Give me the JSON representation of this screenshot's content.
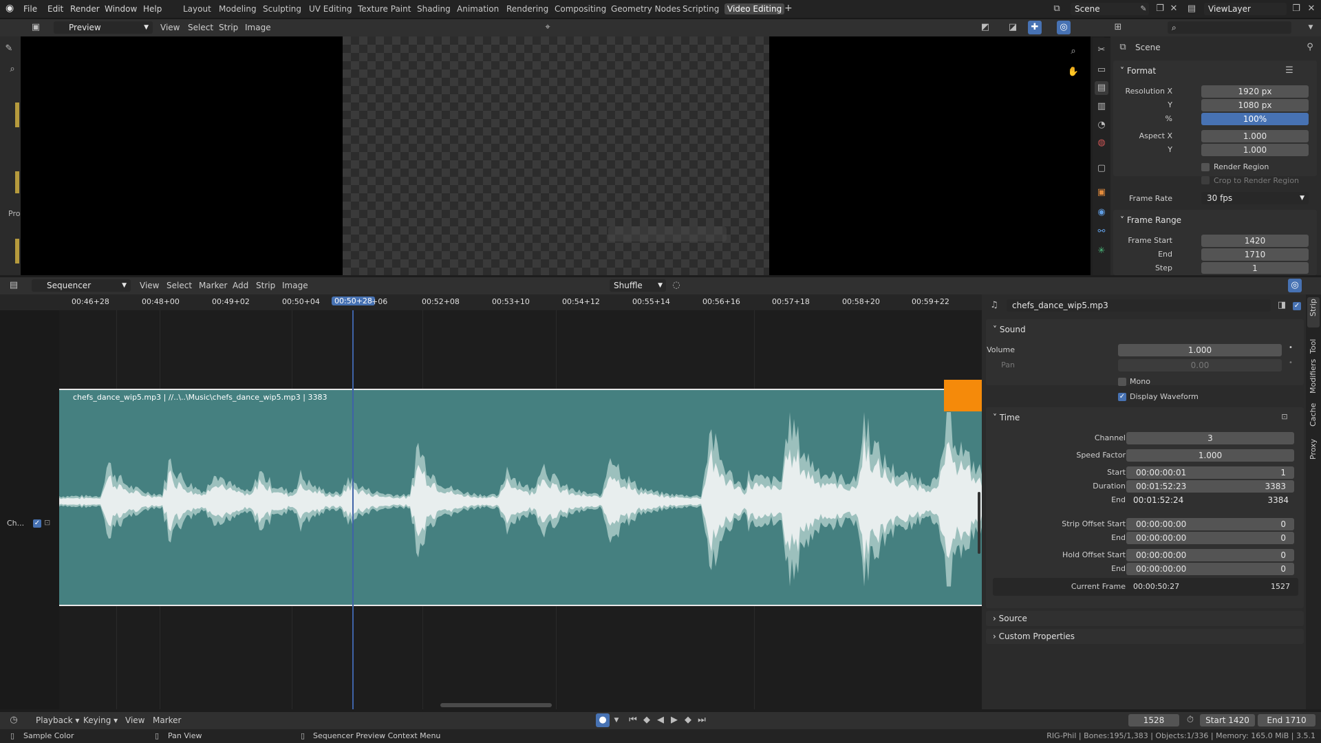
{
  "topbar": {
    "menus": [
      "File",
      "Edit",
      "Render",
      "Window",
      "Help"
    ],
    "workspaces": [
      "Layout",
      "Modeling",
      "Sculpting",
      "UV Editing",
      "Texture Paint",
      "Shading",
      "Animation",
      "Rendering",
      "Compositing",
      "Geometry Nodes",
      "Scripting",
      "Video Editing"
    ],
    "active_workspace": "Video Editing",
    "add_tab": "+",
    "scene_name": "Scene",
    "view_layer": "ViewLayer"
  },
  "preview": {
    "mode": "Preview",
    "menus": [
      "View",
      "Select",
      "Strip",
      "Image"
    ],
    "sidebar_label": "Pro"
  },
  "properties": {
    "scene_label": "Scene",
    "format": {
      "title": "Format",
      "resolution_x_label": "Resolution X",
      "resolution_x": "1920 px",
      "y_label": "Y",
      "resolution_y": "1080 px",
      "pct_label": "%",
      "resolution_pct": "100%",
      "aspect_x_label": "Aspect X",
      "aspect_x": "1.000",
      "aspect_y_label": "Y",
      "aspect_y": "1.000",
      "render_region": "Render Region",
      "crop_region": "Crop to Render Region",
      "frame_rate_label": "Frame Rate",
      "frame_rate": "30 fps"
    },
    "frame_range": {
      "title": "Frame Range",
      "start_label": "Frame Start",
      "start": "1420",
      "end_label": "End",
      "end": "1710",
      "step_label": "Step",
      "step": "1"
    }
  },
  "sequencer": {
    "title": "Sequencer",
    "menus": [
      "View",
      "Select",
      "Marker",
      "Add",
      "Strip",
      "Image"
    ],
    "overlap_mode": "Shuffle",
    "ruler": [
      "00:46+28",
      "00:48+00",
      "00:49+02",
      "00:50+04",
      "00:50+28",
      "+06",
      "00:52+08",
      "00:53+10",
      "00:54+12",
      "00:55+14",
      "00:56+16",
      "00:57+18",
      "00:58+20",
      "00:59+22"
    ],
    "current_time": "00:50+28",
    "channel_label": "Ch...",
    "strip_label": "chefs_dance_wip5.mp3 | //..\\..\\Music\\chefs_dance_wip5.mp3 | 3383"
  },
  "strip_panel": {
    "strip_name": "chefs_dance_wip5.mp3",
    "tabs": [
      "Strip",
      "Tool",
      "Modifiers",
      "Cache",
      "Proxy"
    ],
    "sound": {
      "title": "Sound",
      "volume_label": "Volume",
      "volume": "1.000",
      "pan_label": "Pan",
      "pan": "0.00",
      "mono": "Mono",
      "display_waveform": "Display Waveform"
    },
    "time": {
      "title": "Time",
      "channel_label": "Channel",
      "channel": "3",
      "speed_label": "Speed Factor",
      "speed": "1.000",
      "start_label": "Start",
      "start_tc": "00:00:00:01",
      "start_frames": "1",
      "duration_label": "Duration",
      "duration_tc": "00:01:52:23",
      "duration_frames": "3383",
      "end_label": "End",
      "end_tc": "00:01:52:24",
      "end_frames": "3384",
      "offset_start_label": "Strip Offset Start",
      "offset_start_tc": "00:00:00:00",
      "offset_start_frames": "0",
      "offset_end_label": "End",
      "offset_end_tc": "00:00:00:00",
      "offset_end_frames": "0",
      "hold_start_label": "Hold Offset Start",
      "hold_start_tc": "00:00:00:00",
      "hold_start_frames": "0",
      "hold_end_label": "End",
      "hold_end_tc": "00:00:00:00",
      "hold_end_frames": "0",
      "current_frame_label": "Current Frame",
      "current_frame_tc": "00:00:50:27",
      "current_frame": "1527"
    },
    "source_title": "Source",
    "custom_props_title": "Custom Properties"
  },
  "timeline": {
    "menus": [
      "Playback",
      "Keying",
      "View",
      "Marker"
    ],
    "current_frame": "1528",
    "start_label": "Start",
    "start": "1420",
    "end_label": "End",
    "end": "1710"
  },
  "statusbar": {
    "hint1": "Sample Color",
    "hint2": "Pan View",
    "hint3": "Sequencer Preview Context Menu",
    "stats": "RIG-Phil | Bones:195/1,383 | Objects:1/336 | Memory: 165.0 MiB | 3.5.1"
  },
  "colors": {
    "strip": "#458080",
    "waveform": "#e8eeee",
    "waveform_shadow": "#9cc0bd",
    "arrow": "#f58a0a",
    "accent": "#4772b3",
    "playhead": "#4f7ccc"
  }
}
